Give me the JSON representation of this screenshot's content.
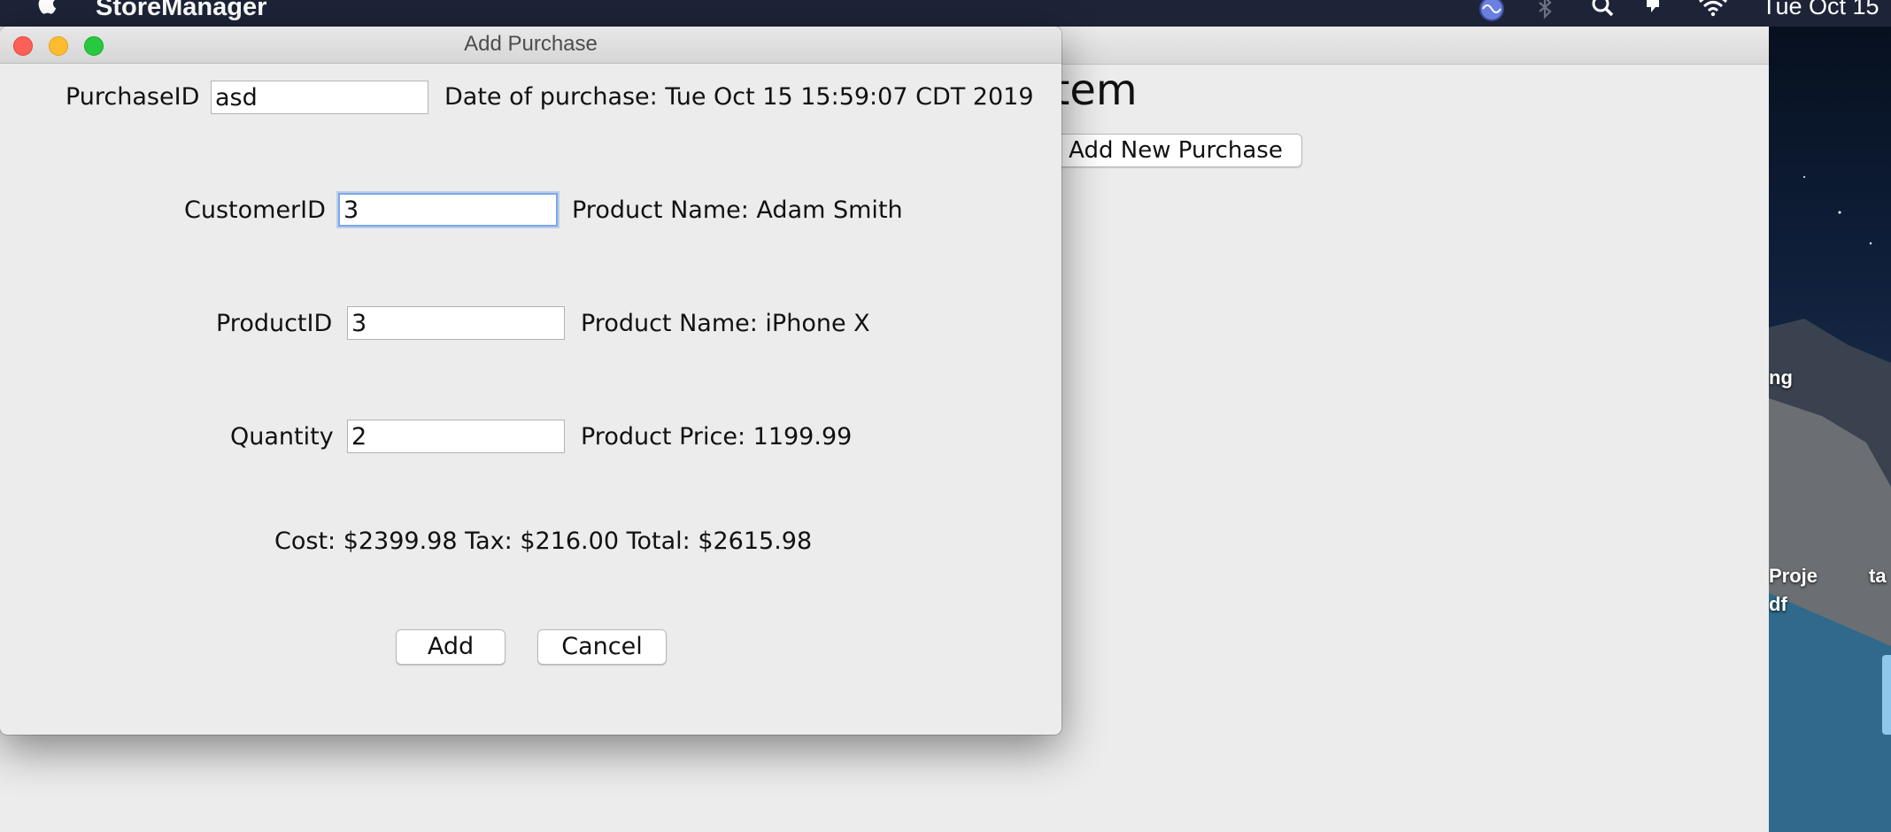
{
  "menubar": {
    "app_name": "StoreManager",
    "clock": "Tue Oct 15",
    "icons": [
      "apple-icon",
      "siri-icon",
      "bluetooth-icon",
      "search-icon",
      "notification-icon",
      "wifi-icon"
    ]
  },
  "desktop": {
    "labels": [
      "ng",
      "Proje",
      "df",
      "ta"
    ]
  },
  "main_window": {
    "heading_visible": "ement System",
    "add_new_purchase_button": "Add New Purchase"
  },
  "dialog": {
    "title": "Add Purchase",
    "purchase_id_label": "PurchaseID",
    "purchase_id_value": "asd",
    "date_text": "Date of purchase: Tue Oct 15 15:59:07 CDT 2019",
    "customer_id_label": "CustomerID",
    "customer_id_value": "3",
    "customer_name_text": "Product Name: Adam Smith",
    "product_id_label": "ProductID",
    "product_id_value": "3",
    "product_name_text": "Product Name: iPhone X",
    "quantity_label": "Quantity",
    "quantity_value": "2",
    "product_price_text": "Product Price: 1199.99",
    "totals_text": "Cost: $2399.98 Tax: $216.00 Total: $2615.98",
    "add_button": "Add",
    "cancel_button": "Cancel"
  },
  "colors": {
    "menubar_bg": "#1d2438",
    "window_bg": "#ececec",
    "focus_ring": "#7aa7ea",
    "close": "#fe5f57",
    "minimize": "#febc2e",
    "zoom": "#28c840"
  }
}
